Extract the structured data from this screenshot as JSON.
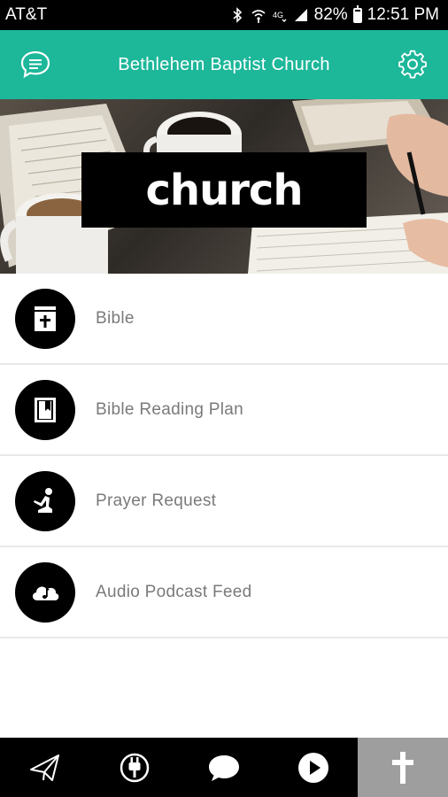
{
  "status_bar": {
    "carrier": "AT&T",
    "battery": "82%",
    "battery_level": 0.82,
    "time": "12:51 PM",
    "icons": [
      "bluetooth-icon",
      "wifi-icon",
      "data-icon",
      "signal-icon",
      "battery-icon"
    ]
  },
  "header": {
    "title": "Bethlehem Baptist Church",
    "left_icon": "chat-icon",
    "right_icon": "gear-icon",
    "accent_color": "#1db79a"
  },
  "banner": {
    "label": "church"
  },
  "menu": {
    "items": [
      {
        "label": "Bible",
        "icon": "bible-icon"
      },
      {
        "label": "Bible Reading Plan",
        "icon": "book-bookmark-icon"
      },
      {
        "label": "Prayer Request",
        "icon": "praying-person-icon"
      },
      {
        "label": "Audio Podcast Feed",
        "icon": "cloud-music-icon"
      }
    ]
  },
  "bottom_nav": {
    "tabs": [
      {
        "icon": "paper-plane-icon",
        "active": false
      },
      {
        "icon": "plug-icon",
        "active": false
      },
      {
        "icon": "speech-bubble-icon",
        "active": false
      },
      {
        "icon": "play-icon",
        "active": false
      },
      {
        "icon": "cross-icon",
        "active": true
      }
    ],
    "active_color": "#9e9e9e"
  }
}
